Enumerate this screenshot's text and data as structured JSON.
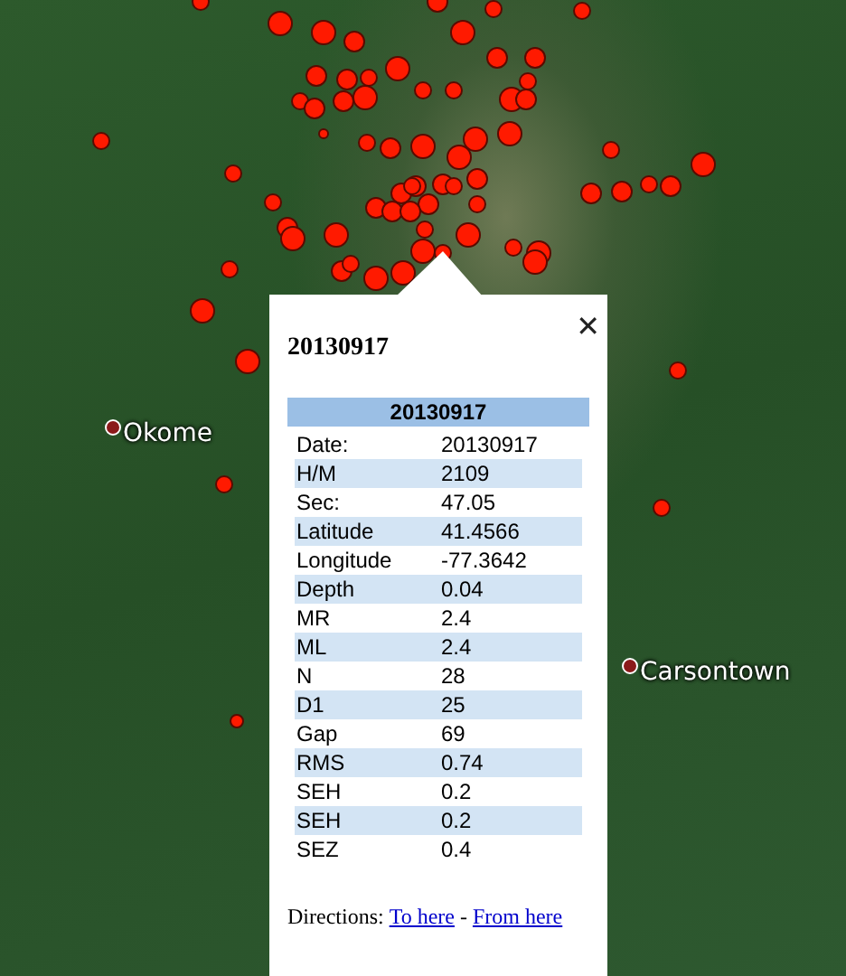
{
  "map": {
    "places": [
      {
        "name": "Okome"
      },
      {
        "name": "Carsontown"
      }
    ]
  },
  "popup": {
    "close": "✕",
    "title": "20130917",
    "table_header": "20130917",
    "rows": [
      {
        "label": "Date:",
        "value": "20130917"
      },
      {
        "label": "H/M",
        "value": "2109"
      },
      {
        "label": "Sec:",
        "value": "47.05"
      },
      {
        "label": "Latitude",
        "value": "41.4566"
      },
      {
        "label": "Longitude",
        "value": "-77.3642"
      },
      {
        "label": "Depth",
        "value": "0.04"
      },
      {
        "label": "MR",
        "value": "2.4"
      },
      {
        "label": "ML",
        "value": "2.4"
      },
      {
        "label": "N",
        "value": "28"
      },
      {
        "label": "D1",
        "value": "25"
      },
      {
        "label": "Gap",
        "value": "69"
      },
      {
        "label": "RMS",
        "value": "0.74"
      },
      {
        "label": "SEH",
        "value": "0.2"
      },
      {
        "label": "SEH",
        "value": "0.2"
      },
      {
        "label": "SEZ",
        "value": "0.4"
      }
    ],
    "directions": {
      "label": "Directions:",
      "separator": "-",
      "links": [
        "To here",
        "From here"
      ]
    }
  }
}
